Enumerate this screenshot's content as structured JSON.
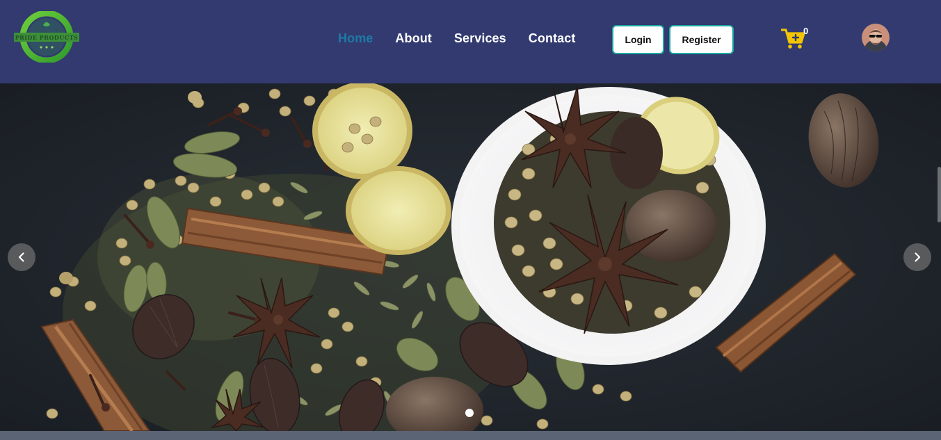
{
  "header": {
    "logo_text": "PRIDE PRODUCTS",
    "nav": [
      {
        "label": "Home",
        "active": true
      },
      {
        "label": "About",
        "active": false
      },
      {
        "label": "Services",
        "active": false
      },
      {
        "label": "Contact",
        "active": false
      }
    ],
    "login_label": "Login",
    "register_label": "Register",
    "cart_count": "0",
    "cart_icon": "cart-plus-icon",
    "avatar_icon": "user-avatar"
  },
  "hero": {
    "image": "spices-bowl-photo",
    "prev_icon": "chevron-left-icon",
    "next_icon": "chevron-right-icon",
    "slides": 1,
    "active_slide": 1
  },
  "colors": {
    "navbar": "#323a70",
    "active_link": "#1e7aa6",
    "button_border": "#1aa7a0",
    "cart": "#f2c500"
  }
}
